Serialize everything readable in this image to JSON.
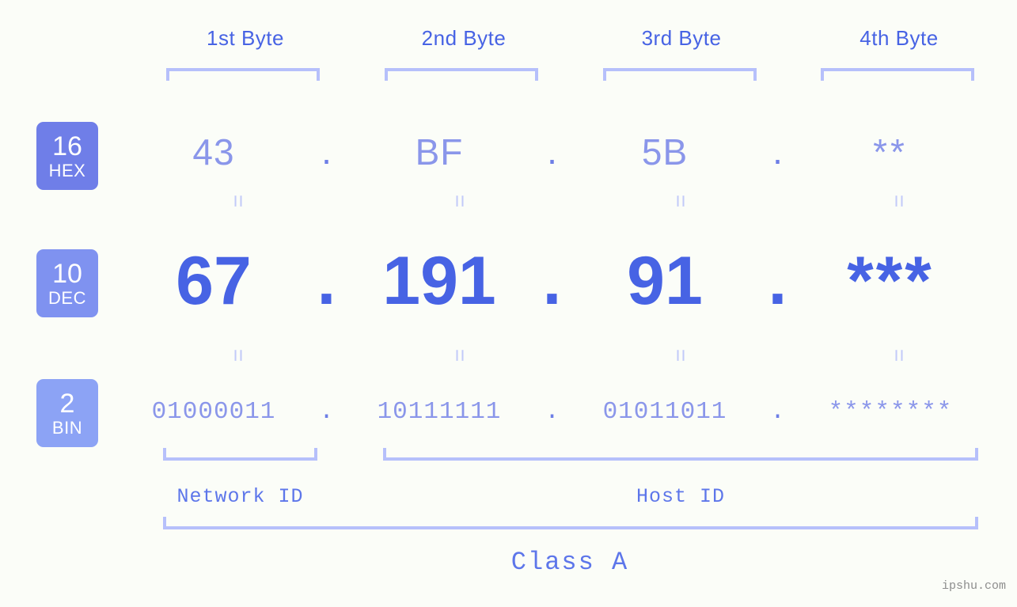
{
  "watermark": "ipshu.com",
  "class_label": "Class A",
  "byte_headers": [
    {
      "label": "1st Byte"
    },
    {
      "label": "2nd Byte"
    },
    {
      "label": "3rd Byte"
    },
    {
      "label": "4th Byte"
    }
  ],
  "bases": [
    {
      "num": "16",
      "name": "HEX",
      "color": "#6f7ee8"
    },
    {
      "num": "10",
      "name": "DEC",
      "color": "#7f92f0"
    },
    {
      "num": "2",
      "name": "BIN",
      "color": "#8ca3f5"
    }
  ],
  "rows": {
    "hex": {
      "values": [
        "43",
        "BF",
        "5B",
        "**"
      ],
      "separators": [
        ".",
        ".",
        "."
      ]
    },
    "dec": {
      "values": [
        "67",
        "191",
        "91",
        "***"
      ],
      "separators": [
        ".",
        ".",
        "."
      ]
    },
    "bin": {
      "values": [
        "01000011",
        "10111111",
        "01011011",
        "********"
      ],
      "separators": [
        ".",
        ".",
        "."
      ]
    }
  },
  "equals_marks": {
    "symbol": "=",
    "count_per_row": 4
  },
  "id_sections": [
    {
      "label": "Network ID"
    },
    {
      "label": "Host ID"
    }
  ],
  "colors": {
    "background": "#fbfdf8",
    "accent_strong": "#4763e4",
    "accent_medium": "#6d7ee6",
    "accent_light": "#8a96ea",
    "bracket": "#b6c0fb",
    "equals": "#c2caf9",
    "watermark": "#8d8d8d"
  }
}
